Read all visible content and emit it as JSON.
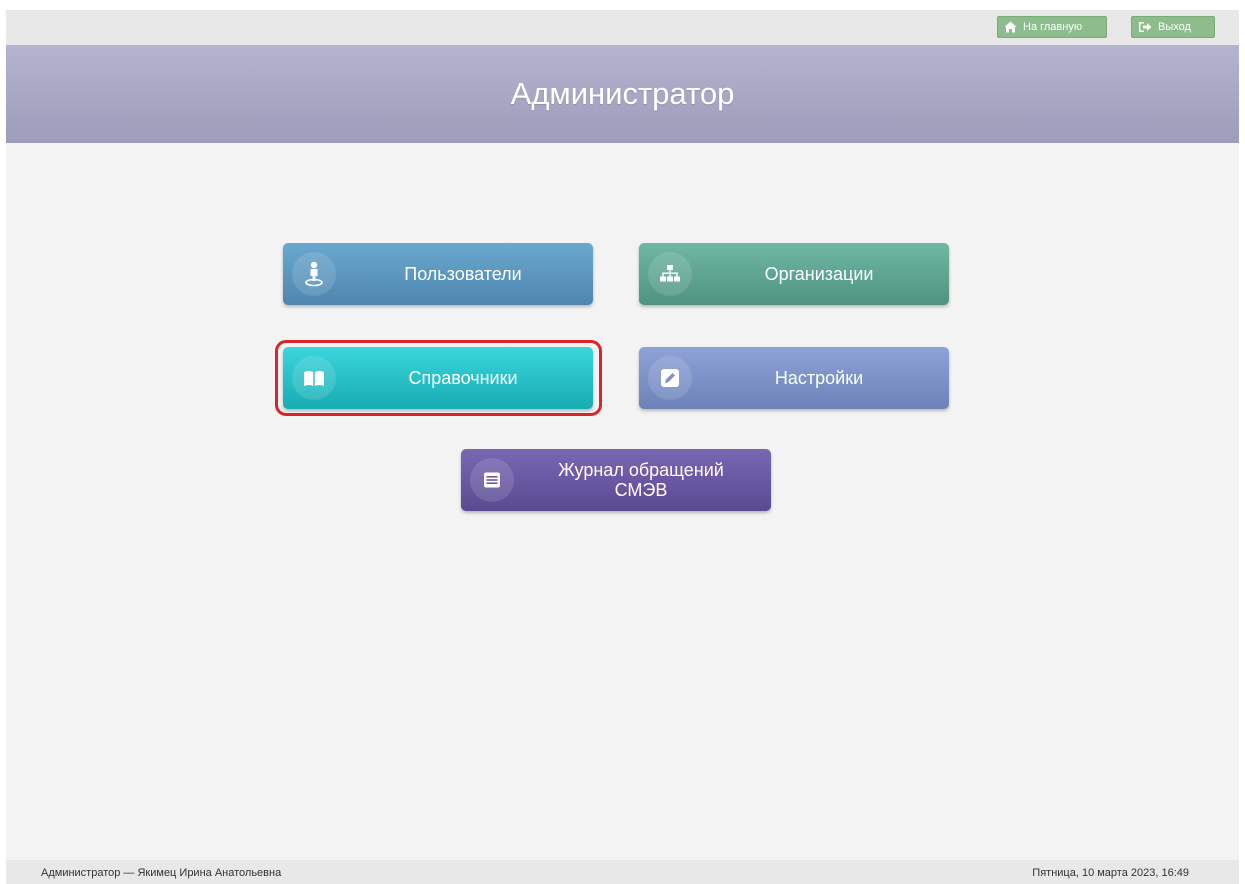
{
  "topbar": {
    "home_label": "На главную",
    "exit_label": "Выход",
    "home_icon": "home-icon",
    "exit_icon": "sign-out-icon",
    "button_color": "#8dbd8d"
  },
  "header": {
    "title": "Администратор",
    "color": "#a6a6c4"
  },
  "tiles": [
    {
      "label": "Пользователи",
      "icon": "user-icon",
      "color": "#5a95bd"
    },
    {
      "label": "Организации",
      "icon": "sitemap-icon",
      "color": "#5fa590"
    },
    {
      "label": "Справочники",
      "icon": "book-icon",
      "color": "#26c2c8",
      "highlighted": true
    },
    {
      "label": "Настройки",
      "icon": "pencil-icon",
      "color": "#7d92c8"
    },
    {
      "label_line1": "Журнал обращений",
      "label_line2": "СМЭВ",
      "icon": "list-icon",
      "color": "#6859a3"
    }
  ],
  "highlight_color": "#d9252a",
  "footer": {
    "user": "Администратор — Якимец Ирина Анатольевна",
    "datetime": "Пятница, 10 марта 2023, 16:49"
  }
}
